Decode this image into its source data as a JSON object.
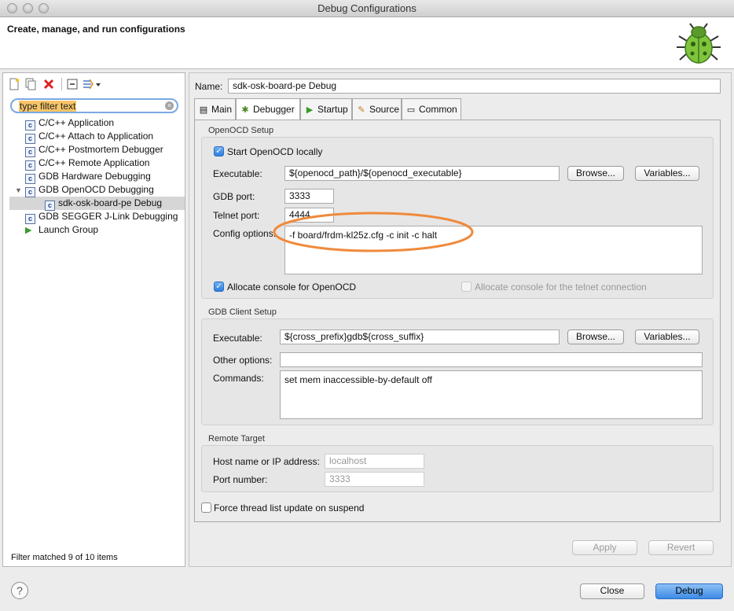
{
  "window": {
    "title": "Debug Configurations"
  },
  "header": {
    "title": "Create, manage, and run configurations",
    "icon": "bug-icon"
  },
  "left": {
    "toolbar": [
      "new-config-icon",
      "duplicate-icon",
      "delete-icon",
      "collapse-all-icon",
      "filter-menu-icon"
    ],
    "filter": {
      "value": "type filter text"
    },
    "tree": [
      {
        "label": "C/C++ Application",
        "type": "c"
      },
      {
        "label": "C/C++ Attach to Application",
        "type": "c"
      },
      {
        "label": "C/C++ Postmortem Debugger",
        "type": "c"
      },
      {
        "label": "C/C++ Remote Application",
        "type": "c"
      },
      {
        "label": "GDB Hardware Debugging",
        "type": "c"
      },
      {
        "label": "GDB OpenOCD Debugging",
        "type": "c",
        "expanded": true
      },
      {
        "label": "sdk-osk-board-pe Debug",
        "type": "c",
        "child": true,
        "selected": true
      },
      {
        "label": "GDB SEGGER J-Link Debugging",
        "type": "c"
      },
      {
        "label": "Launch Group",
        "type": "launch"
      }
    ],
    "status": "Filter matched 9 of 10 items"
  },
  "right": {
    "name_label": "Name:",
    "name_value": "sdk-osk-board-pe Debug",
    "tabs": [
      {
        "label": "Main",
        "icon": "main-tab-icon"
      },
      {
        "label": "Debugger",
        "icon": "debugger-bug-icon",
        "active": true
      },
      {
        "label": "Startup",
        "icon": "play-icon"
      },
      {
        "label": "Source",
        "icon": "source-icon"
      },
      {
        "label": "Common",
        "icon": "common-icon"
      }
    ],
    "openocd": {
      "title": "OpenOCD Setup",
      "start_locally": "Start OpenOCD locally",
      "executable_label": "Executable:",
      "executable_value": "${openocd_path}/${openocd_executable}",
      "browse": "Browse...",
      "variables": "Variables...",
      "gdb_port_label": "GDB port:",
      "gdb_port_value": "3333",
      "telnet_port_label": "Telnet port:",
      "telnet_port_value": "4444",
      "config_label": "Config options:",
      "config_value": "-f board/frdm-kl25z.cfg -c init -c halt",
      "allocate_console": "Allocate console for OpenOCD",
      "allocate_telnet": "Allocate console for the telnet connection"
    },
    "gdbclient": {
      "title": "GDB Client Setup",
      "executable_label": "Executable:",
      "executable_value": "${cross_prefix}gdb${cross_suffix}",
      "browse": "Browse...",
      "variables": "Variables...",
      "other_label": "Other options:",
      "other_value": "",
      "commands_label": "Commands:",
      "commands_value": "set mem inaccessible-by-default off"
    },
    "remote": {
      "title": "Remote Target",
      "host_label": "Host name or IP address:",
      "host_value": "localhost",
      "port_label": "Port number:",
      "port_value": "3333"
    },
    "force_thread": "Force thread list update on suspend",
    "apply": "Apply",
    "revert": "Revert"
  },
  "footer": {
    "close": "Close",
    "debug": "Debug",
    "help_glyph": "?"
  },
  "colors": {
    "annotation": "#f08a3c",
    "accent": "#3d8ae6"
  }
}
